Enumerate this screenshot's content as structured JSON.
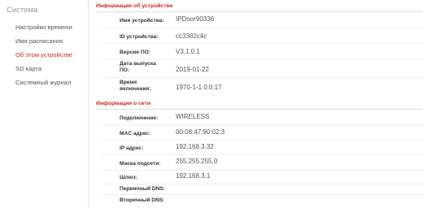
{
  "sidebar": {
    "title": "Система",
    "items": [
      {
        "label": "Настройки времени",
        "active": false
      },
      {
        "label": "Имя расписания",
        "active": false
      },
      {
        "label": "Об этом устройстве",
        "active": true
      },
      {
        "label": "SD карта",
        "active": false
      },
      {
        "label": "Системный журнал",
        "active": false
      }
    ]
  },
  "device_info": {
    "header": "Информация об устройстве",
    "rows": [
      {
        "label": "Имя устройства:",
        "value": "IPDoor90336"
      },
      {
        "label": "ID устройства:",
        "value": "cc3382c4c"
      },
      {
        "label": "Версия ПО:",
        "value": "V3.1.0.1"
      },
      {
        "label": "Дата выпуска ПО:",
        "value": "2019-01-22"
      },
      {
        "label": "Время включения:",
        "value": "1970-1-1 0:0:17"
      }
    ]
  },
  "network_info": {
    "header": "Информация о сети",
    "rows": [
      {
        "label": "Подключение:",
        "value": "WIRELESS"
      },
      {
        "label": "MAC адрес:",
        "value": "00:08:47:90:02:3"
      },
      {
        "label": "IP адрес:",
        "value": "192.168.3.32"
      },
      {
        "label": "Маска подсети:",
        "value": "255.255.255.0"
      },
      {
        "label": "Шлюз:",
        "value": "192.168.3.1"
      },
      {
        "label": "Первичный DNS:",
        "value": ""
      },
      {
        "label": "Вторичный DNS:",
        "value": ""
      }
    ]
  },
  "colors": {
    "accent": "#d8261d",
    "text": "#555555",
    "muted": "#9a9a9a"
  }
}
